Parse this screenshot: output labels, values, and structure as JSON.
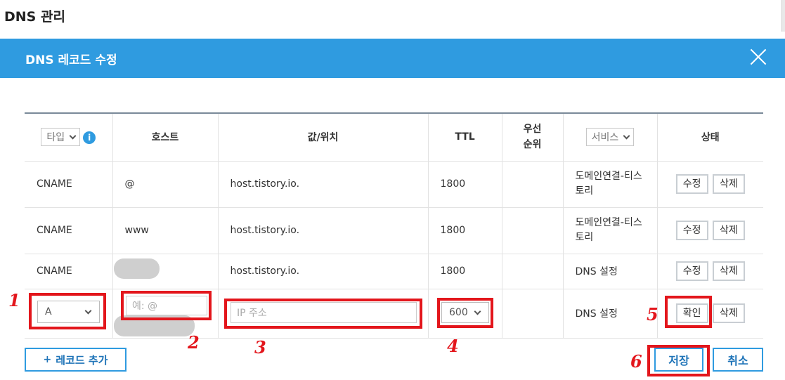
{
  "page": {
    "title": "DNS 관리"
  },
  "modal": {
    "title": "DNS 레코드 수정"
  },
  "table": {
    "headers": {
      "type": "타입",
      "host": "호스트",
      "value": "값/위치",
      "ttl": "TTL",
      "priority": "우선\n순위",
      "service": "서비스",
      "status": "상태"
    },
    "rows": [
      {
        "type": "CNAME",
        "host": "@",
        "value": "host.tistory.io.",
        "ttl": "1800",
        "priority": "",
        "service": "도메인연결-티스토리",
        "edit": "수정",
        "delete": "삭제"
      },
      {
        "type": "CNAME",
        "host": "www",
        "value": "host.tistory.io.",
        "ttl": "1800",
        "priority": "",
        "service": "도메인연결-티스토리",
        "edit": "수정",
        "delete": "삭제"
      },
      {
        "type": "CNAME",
        "host": "",
        "value": "host.tistory.io.",
        "ttl": "1800",
        "priority": "",
        "service": "DNS 설정",
        "edit": "수정",
        "delete": "삭제"
      }
    ],
    "new_row": {
      "type_selected": "A",
      "host_placeholder": "예: @",
      "value_placeholder": "IP 주소",
      "ttl_selected": "600",
      "service": "DNS 설정",
      "confirm": "확인",
      "delete": "삭제"
    }
  },
  "annotations": [
    "1",
    "2",
    "3",
    "4",
    "5",
    "6"
  ],
  "footer": {
    "add_record": "레코드 추가",
    "save": "저장",
    "cancel": "취소"
  },
  "colors": {
    "header_bar": "#2f9be0",
    "annotation_red": "#e3161c"
  }
}
